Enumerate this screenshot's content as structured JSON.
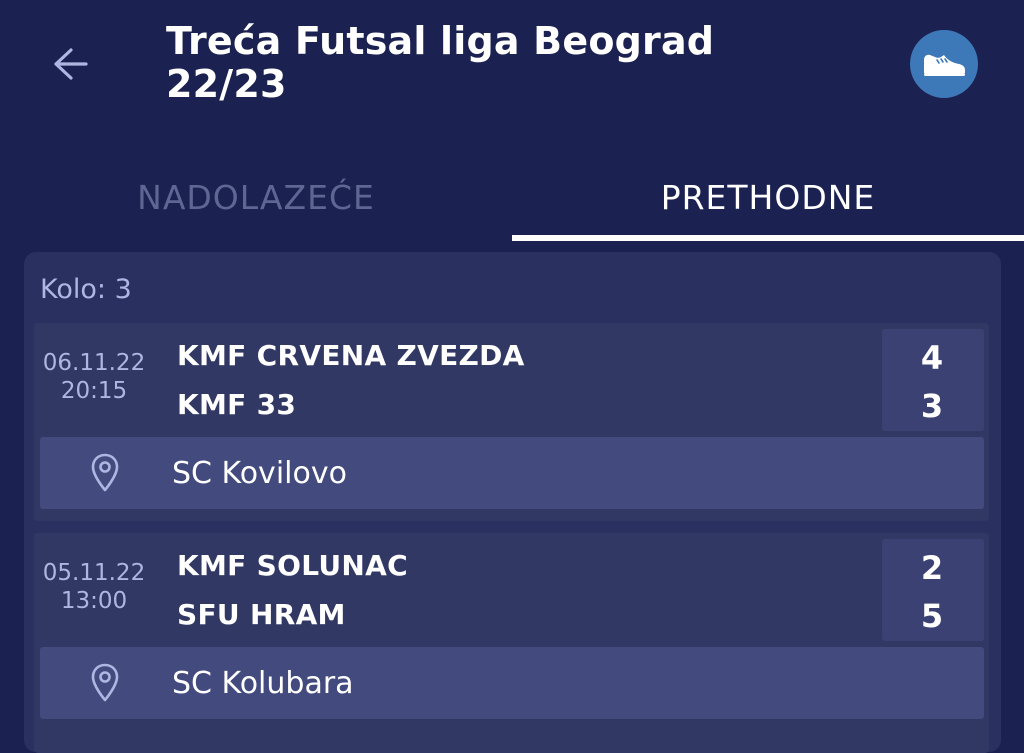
{
  "header": {
    "title_line1": "Treća Futsal liga Beograd",
    "title_line2": "22/23",
    "back_icon": "arrow-left-icon",
    "action_icon": "shoe-icon",
    "accent_color": "#3d78b8"
  },
  "tabs": [
    {
      "label": "NADOLAZEĆE",
      "selected": false
    },
    {
      "label": "PRETHODNE",
      "selected": true
    }
  ],
  "round": {
    "label": "Kolo: 3",
    "matches": [
      {
        "date": "06.11.22",
        "time": "20:15",
        "home_team": "KMF CRVENA ZVEZDA",
        "away_team": "KMF 33",
        "home_score": "4",
        "away_score": "3",
        "venue": "SC Kovilovo"
      },
      {
        "date": "05.11.22",
        "time": "13:00",
        "home_team": "KMF SOLUNAC",
        "away_team": "SFU HRAM",
        "home_score": "2",
        "away_score": "5",
        "venue": "SC Kolubara"
      }
    ]
  },
  "colors": {
    "background": "#1b2150",
    "card": "#2a3060",
    "muted_text": "#aeb6e2",
    "inactive_tab": "#5e6693"
  }
}
